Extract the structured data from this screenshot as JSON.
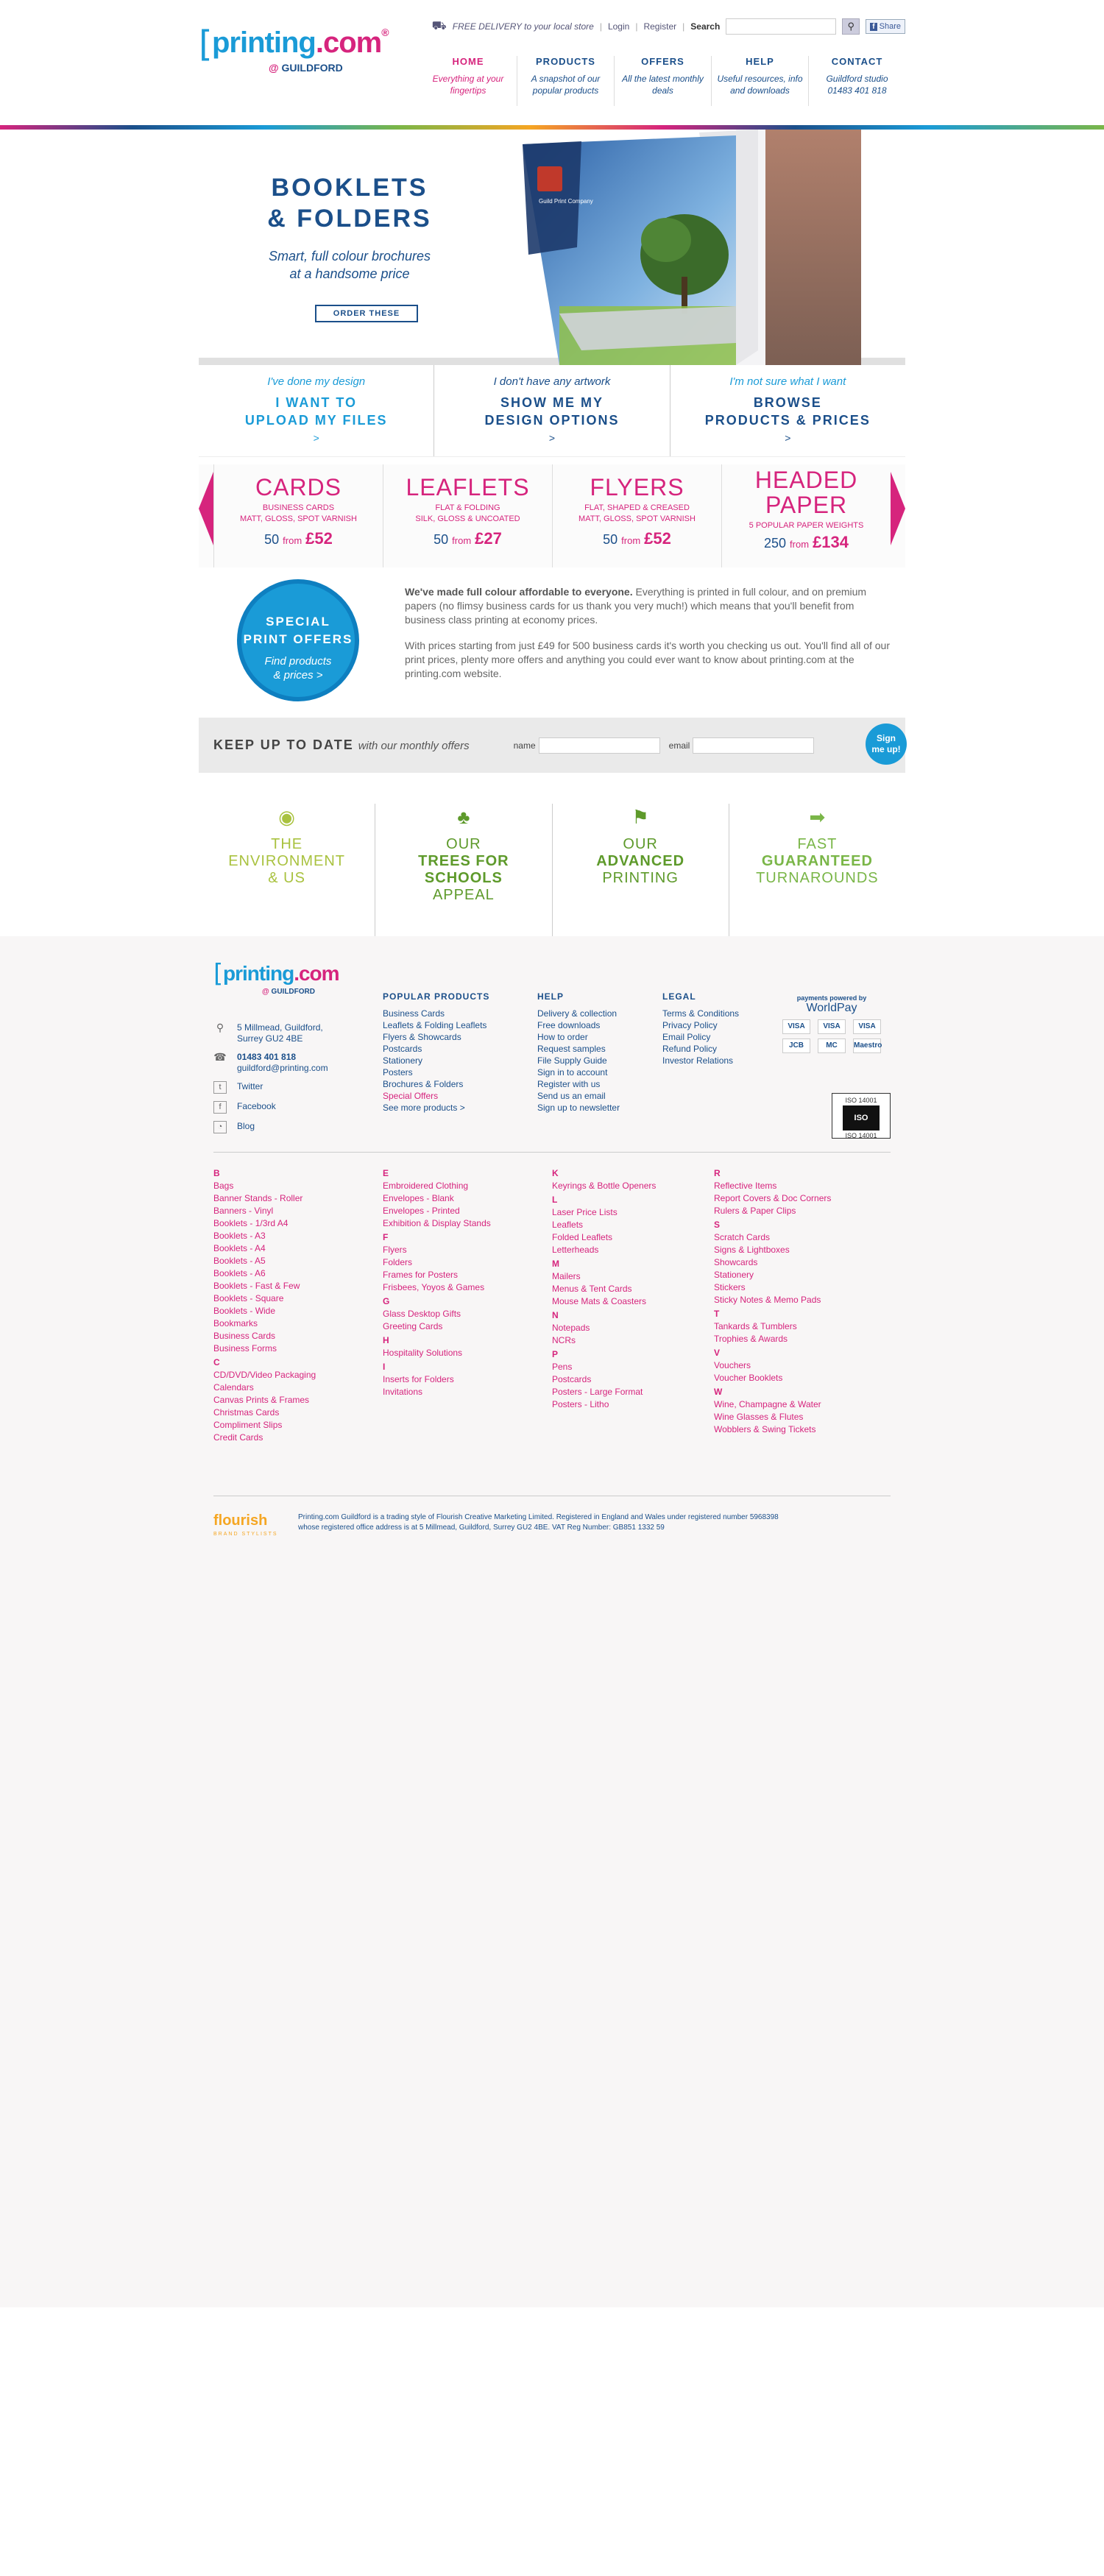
{
  "brand": {
    "logo_word": "printing",
    "logo_com": ".com",
    "logo_sup": "®",
    "logo_sub_at": "@",
    "logo_sub": "GUILDFORD"
  },
  "topbar": {
    "delivery": "FREE DELIVERY to your local store",
    "login": "Login",
    "register": "Register",
    "search_label": "Search",
    "share": "Share"
  },
  "nav": [
    {
      "title": "HOME",
      "sub": "Everything at your fingertips"
    },
    {
      "title": "PRODUCTS",
      "sub": "A snapshot of our popular products"
    },
    {
      "title": "OFFERS",
      "sub": "All the latest monthly deals"
    },
    {
      "title": "HELP",
      "sub": "Useful resources, info and downloads"
    },
    {
      "title": "CONTACT",
      "sub": "Guildford studio 01483 401 818"
    }
  ],
  "hero": {
    "title_1": "BOOKLETS",
    "title_2": "& FOLDERS",
    "tagline_1": "Smart, full colour brochures",
    "tagline_2": "at a handsome price",
    "button": "ORDER THESE",
    "booklet_cover_text": "Guild Print Company"
  },
  "choices": [
    {
      "q": "I've done my design",
      "a1": "I WANT TO",
      "a2": "UPLOAD MY FILES",
      "arrow": ">"
    },
    {
      "q": "I don't have any artwork",
      "a1": "SHOW ME MY",
      "a2": "DESIGN OPTIONS",
      "arrow": ">"
    },
    {
      "q": "I'm not sure what I want",
      "a1": "BROWSE",
      "a2": "PRODUCTS & PRICES",
      "arrow": ">"
    }
  ],
  "products": [
    {
      "title": "CARDS",
      "title2": "",
      "sub1": "BUSINESS CARDS",
      "sub2": "MATT, GLOSS, SPOT VARNISH",
      "qty": "50",
      "from": "from",
      "price": "£52"
    },
    {
      "title": "LEAFLETS",
      "title2": "",
      "sub1": "FLAT & FOLDING",
      "sub2": "SILK, GLOSS & UNCOATED",
      "qty": "50",
      "from": "from",
      "price": "£27"
    },
    {
      "title": "FLYERS",
      "title2": "",
      "sub1": "FLAT, SHAPED & CREASED",
      "sub2": "MATT, GLOSS, SPOT VARNISH",
      "qty": "50",
      "from": "from",
      "price": "£52"
    },
    {
      "title": "HEADED",
      "title2": "PAPER",
      "sub1": "5 POPULAR PAPER WEIGHTS",
      "sub2": "",
      "qty": "250",
      "from": "from",
      "price": "£134"
    }
  ],
  "special": {
    "circle_1": "SPECIAL",
    "circle_2": "PRINT OFFERS",
    "circle_link_1": "Find products",
    "circle_link_2": "& prices >",
    "p1_bold": "We've made full colour affordable to everyone.",
    "p1": " Everything is printed in full colour, and on premium papers (no flimsy business cards for us thank you very much!) which means that you'll benefit from business class printing at economy prices.",
    "p2": "With prices starting from just £49 for 500 business cards it's worth you checking us out. You'll find all of our print prices, plenty more offers and anything you could ever want to know about printing.com at the printing.com website."
  },
  "newsletter": {
    "title": "KEEP UP TO DATE",
    "title_em": "with our monthly offers",
    "name_label": "name",
    "email_label": "email",
    "sign_1": "Sign",
    "sign_2": "me up!"
  },
  "features": [
    {
      "l1": "THE",
      "l2": "ENVIRONMENT",
      "l3": "& US",
      "icon": "globe-icon"
    },
    {
      "l1": "OUR",
      "l2": "TREES FOR",
      "l3": "SCHOOLS",
      "l4": "APPEAL",
      "icon": "tree-icon"
    },
    {
      "l1": "OUR",
      "l2": "ADVANCED",
      "l3": "PRINTING",
      "icon": "flag-icon"
    },
    {
      "l1": "FAST",
      "l2": "GUARANTEED",
      "l3": "TURNAROUNDS",
      "icon": "fast-arrow-icon"
    }
  ],
  "colors": {
    "brand_blue": "#1b4f8a",
    "light_blue": "#1a9bd7",
    "pink": "#d6247d",
    "green": "#7ab648",
    "lime": "#a9c23f",
    "orange": "#f5a623"
  },
  "footer": {
    "address_1": "5 Millmead, Guildford,",
    "address_2": "Surrey GU2 4BE",
    "phone": "01483 401 818",
    "email": "guildford@printing.com",
    "twitter": "Twitter",
    "facebook": "Facebook",
    "blog": "Blog",
    "popular_title": "POPULAR PRODUCTS",
    "popular": [
      "Business Cards",
      "Leaflets & Folding Leaflets",
      "Flyers & Showcards",
      "Postcards",
      "Stationery",
      "Posters",
      "Brochures & Folders",
      "Special Offers",
      "See more products >"
    ],
    "help_title": "HELP",
    "help": [
      "Delivery & collection",
      "Free downloads",
      "How to order",
      "Request samples",
      "File Supply Guide",
      "Sign in to account",
      "Register with us",
      "Send us an email",
      "Sign up to newsletter"
    ],
    "legal_title": "LEGAL",
    "legal": [
      "Terms & Conditions",
      "Privacy Policy",
      "Email Policy",
      "Refund Policy",
      "Investor Relations"
    ],
    "wp_small": "payments powered by",
    "wp": "WorldPay",
    "cards": [
      "VISA",
      "VISA",
      "VISA",
      "JCB",
      "MC",
      "Maestro"
    ],
    "iso_top": "ISO 14001",
    "iso_mark": "ISO",
    "iso_bottom": "ISO 14001"
  },
  "atoz": [
    [
      {
        "L": "B",
        "items": [
          "Bags",
          "Banner Stands - Roller",
          "Banners - Vinyl",
          "Booklets - 1/3rd A4",
          "Booklets - A3",
          "Booklets - A4",
          "Booklets - A5",
          "Booklets - A6",
          "Booklets - Fast & Few",
          "Booklets - Square",
          "Booklets - Wide",
          "Bookmarks",
          "Business Cards",
          "Business Forms"
        ]
      },
      {
        "L": "C",
        "items": [
          "CD/DVD/Video Packaging",
          "Calendars",
          "Canvas Prints & Frames",
          "Christmas Cards",
          "Compliment Slips",
          "Credit Cards"
        ]
      }
    ],
    [
      {
        "L": "E",
        "items": [
          "Embroidered Clothing",
          "Envelopes - Blank",
          "Envelopes - Printed",
          "Exhibition & Display Stands"
        ]
      },
      {
        "L": "F",
        "items": [
          "Flyers",
          "Folders",
          "Frames for Posters",
          "Frisbees, Yoyos & Games"
        ]
      },
      {
        "L": "G",
        "items": [
          "Glass Desktop Gifts",
          "Greeting Cards"
        ]
      },
      {
        "L": "H",
        "items": [
          "Hospitality Solutions"
        ]
      },
      {
        "L": "I",
        "items": [
          "Inserts for Folders",
          "Invitations"
        ]
      }
    ],
    [
      {
        "L": "K",
        "items": [
          "Keyrings & Bottle Openers"
        ]
      },
      {
        "L": "L",
        "items": [
          "Laser Price Lists",
          "Leaflets",
          "Folded Leaflets",
          "Letterheads"
        ]
      },
      {
        "L": "M",
        "items": [
          "Mailers",
          "Menus & Tent Cards",
          "Mouse Mats & Coasters"
        ]
      },
      {
        "L": "N",
        "items": [
          "Notepads",
          "NCRs"
        ]
      },
      {
        "L": "P",
        "items": [
          "Pens",
          "Postcards",
          "Posters - Large Format",
          "Posters - Litho"
        ]
      }
    ],
    [
      {
        "L": "R",
        "items": [
          "Reflective Items",
          "Report Covers & Doc Corners",
          "Rulers & Paper Clips"
        ]
      },
      {
        "L": "S",
        "items": [
          "Scratch Cards",
          "Signs & Lightboxes",
          "Showcards",
          "Stationery",
          "Stickers",
          "Sticky Notes & Memo Pads"
        ]
      },
      {
        "L": "T",
        "items": [
          "Tankards & Tumblers",
          "Trophies & Awards"
        ]
      },
      {
        "L": "V",
        "items": [
          "Vouchers",
          "Voucher Booklets"
        ]
      },
      {
        "L": "W",
        "items": [
          "Wine, Champagne & Water",
          "Wine Glasses & Flutes",
          "Wobblers & Swing Tickets"
        ]
      }
    ]
  ],
  "flourish": {
    "name": "flourish",
    "tag": "BRAND STYLISTS",
    "line1": "Printing.com Guildford is a trading style of Flourish Creative Marketing Limited. Registered in England and Wales under registered number 5968398",
    "line2": "whose registered office address is at 5 Millmead, Guildford, Surrey GU2 4BE. VAT Reg Number: GB851 1332 59"
  }
}
